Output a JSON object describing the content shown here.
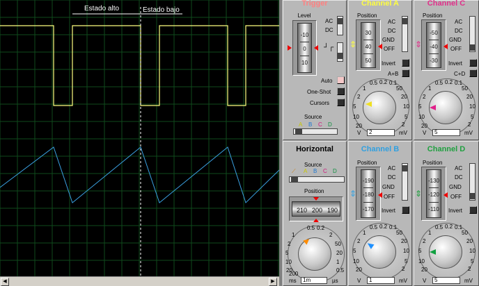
{
  "scope": {
    "annotation_high": "Estado alto",
    "annotation_low": "Estado bajo",
    "trace_a_color": "#ffff80",
    "trace_b_color": "#3aa0e0",
    "grid_color": "#0f4a1c"
  },
  "trigger": {
    "title": "Trigger",
    "level_label": "Level",
    "scale": [
      "-10",
      "0",
      "10"
    ],
    "ac": "AC",
    "dc": "DC",
    "auto": "Auto",
    "one_shot": "One-Shot",
    "cursors": "Cursors",
    "source_label": "Source",
    "source_letters": [
      "A",
      "B",
      "C",
      "D"
    ],
    "title_color": "#ff8080"
  },
  "horizontal": {
    "title": "Horizontal",
    "source_label": "Source",
    "source_letters": [
      "A",
      "B",
      "C",
      "D"
    ],
    "position_label": "Position",
    "scale": [
      "210",
      "200",
      "190"
    ],
    "dial_marks": [
      "1",
      "2",
      "5",
      "10",
      "20",
      "50",
      "100",
      "200",
      "0.5",
      "0.2",
      "0.1",
      "0.05",
      "0.5",
      "1",
      "2",
      "5",
      "10",
      "20",
      "50"
    ],
    "unit_left": "ms",
    "unit_right": "µs",
    "value": "1m",
    "bottom_left": "200",
    "title_color": "#ff8c00"
  },
  "channels": {
    "a": {
      "title": "Channel A",
      "position_label": "Position",
      "scale": [
        "30",
        "40",
        "50"
      ],
      "value": "2",
      "unit_left": "V",
      "unit_right": "mV",
      "extra": "A+B",
      "color": "#ffff40",
      "knob_color": "#f0e020"
    },
    "b": {
      "title": "Channel B",
      "position_label": "Position",
      "scale": [
        "-190",
        "-180",
        "-170"
      ],
      "value": "1",
      "unit_left": "V",
      "unit_right": "mV",
      "extra": "",
      "color": "#30a0e0",
      "knob_color": "#1e90ff"
    },
    "c": {
      "title": "Channel C",
      "position_label": "Position",
      "scale": [
        "-50",
        "-40",
        "-30"
      ],
      "value": "5",
      "unit_left": "V",
      "unit_right": "mV",
      "extra": "C+D",
      "color": "#e0308a",
      "knob_color": "#e0208a"
    },
    "d": {
      "title": "Channel D",
      "position_label": "Position",
      "scale": [
        "-130",
        "-120",
        "-110"
      ],
      "value": "5",
      "unit_left": "V",
      "unit_right": "mV",
      "extra": "",
      "color": "#20a040",
      "knob_color": "#10a040"
    }
  },
  "coupling": {
    "ac": "AC",
    "dc": "DC",
    "gnd": "GND",
    "off": "OFF",
    "invert": "Invert"
  },
  "volt_dial_marks": [
    "0.5",
    "0.2",
    "0.1",
    "50",
    "20",
    "10",
    "5",
    "2",
    "1",
    "1",
    "2",
    "5",
    "10",
    "20"
  ],
  "scrollbar": {
    "left_arrow": "◀",
    "right_arrow": "▶"
  }
}
